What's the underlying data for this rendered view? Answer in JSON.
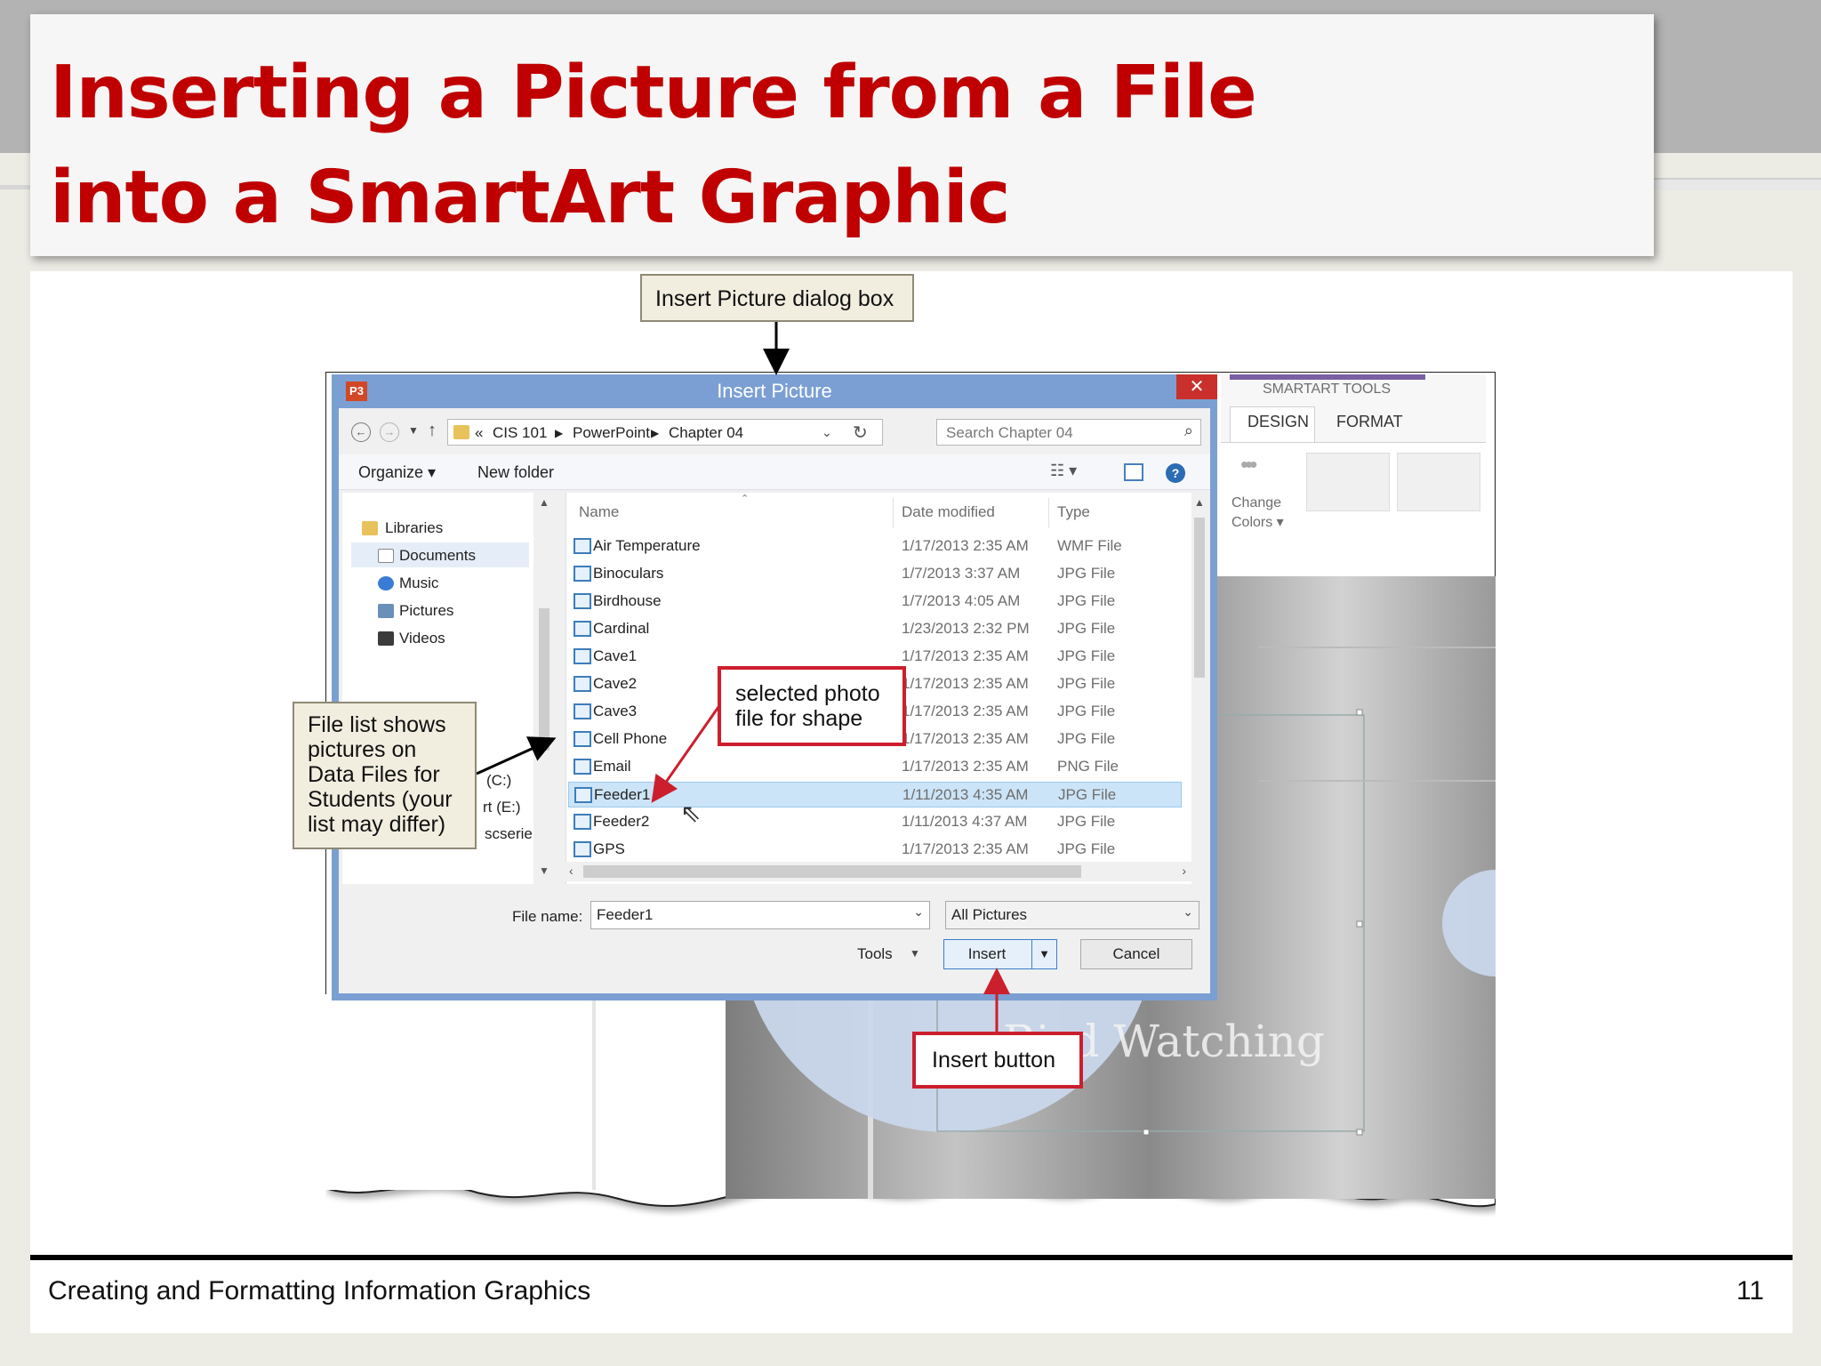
{
  "slide": {
    "title_line1": "Inserting a Picture from a File",
    "title_line2": "into a SmartArt Graphic",
    "footer_text": "Creating and Formatting Information Graphics",
    "page_number": "11"
  },
  "callouts": {
    "dialog_box": "Insert Picture dialog box",
    "selected_photo_line1": "selected photo",
    "selected_photo_line2": "file for shape",
    "file_list_line1": "File list shows",
    "file_list_line2": "pictures on",
    "file_list_line3": "Data Files for",
    "file_list_line4": "Students (your",
    "file_list_line5": "list may differ)",
    "insert_button": "Insert button"
  },
  "dialog": {
    "title": "Insert Picture",
    "close_glyph": "✕",
    "app_icon": "P3",
    "address": {
      "prefix": "«",
      "crumbs": [
        "CIS 101",
        "PowerPoint",
        "Chapter 04"
      ]
    },
    "search_placeholder": "Search Chapter 04",
    "organize_label": "Organize ▾",
    "new_folder_label": "New folder",
    "nav": {
      "libraries": "Libraries",
      "documents": "Documents",
      "music": "Music",
      "pictures": "Pictures",
      "videos": "Videos",
      "drive_c": "(C:)",
      "drive_e": "rt (E:)",
      "drive_other": "scserie"
    },
    "columns": {
      "name": "Name",
      "date": "Date modified",
      "type": "Type"
    },
    "files": [
      {
        "name": "Air Temperature",
        "date": "1/17/2013 2:35 AM",
        "type": "WMF File"
      },
      {
        "name": "Binoculars",
        "date": "1/7/2013 3:37 AM",
        "type": "JPG File"
      },
      {
        "name": "Birdhouse",
        "date": "1/7/2013 4:05 AM",
        "type": "JPG File"
      },
      {
        "name": "Cardinal",
        "date": "1/23/2013 2:32 PM",
        "type": "JPG File"
      },
      {
        "name": "Cave1",
        "date": "1/17/2013 2:35 AM",
        "type": "JPG File"
      },
      {
        "name": "Cave2",
        "date": "1/17/2013 2:35 AM",
        "type": "JPG File"
      },
      {
        "name": "Cave3",
        "date": "1/17/2013 2:35 AM",
        "type": "JPG File"
      },
      {
        "name": "Cell Phone",
        "date": "1/17/2013 2:35 AM",
        "type": "JPG File"
      },
      {
        "name": "Email",
        "date": "1/17/2013 2:35 AM",
        "type": "PNG File"
      },
      {
        "name": "Feeder1",
        "date": "1/11/2013 4:35 AM",
        "type": "JPG File"
      },
      {
        "name": "Feeder2",
        "date": "1/11/2013 4:37 AM",
        "type": "JPG File"
      },
      {
        "name": "GPS",
        "date": "1/17/2013 2:35 AM",
        "type": "JPG File"
      }
    ],
    "selected_file": "Feeder1",
    "file_name_label": "File name:",
    "file_name_value": "Feeder1",
    "filter_value": "All Pictures",
    "tools_label": "Tools",
    "insert_label": "Insert",
    "cancel_label": "Cancel"
  },
  "ribbon": {
    "group_label": "SMARTART TOOLS",
    "tab_design": "DESIGN",
    "tab_format": "FORMAT",
    "change_colors_line1": "Change",
    "change_colors_line2": "Colors ▾"
  },
  "background_art": {
    "text": "Bird Watching"
  },
  "colors": {
    "title_red": "#c00000",
    "callout_red_border": "#cc1f2e",
    "dialog_frame": "#7b9fd3",
    "selection": "#cce4f7"
  }
}
